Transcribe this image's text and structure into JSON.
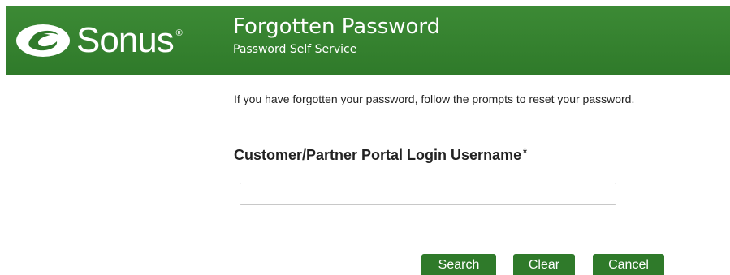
{
  "header": {
    "logo_text": "Sonus",
    "logo_reg": "®",
    "title": "Forgotten Password",
    "subtitle": "Password Self Service"
  },
  "form": {
    "intro": "If you have forgotten your password, follow the prompts to reset your password.",
    "username_label": "Customer/Partner Portal Login Username",
    "required_mark": "*",
    "username_value": "",
    "username_placeholder": ""
  },
  "buttons": {
    "search": "Search",
    "clear": "Clear",
    "cancel": "Cancel"
  },
  "colors": {
    "header_green": "#2f7a2a",
    "button_green": "#2f7a2a"
  }
}
